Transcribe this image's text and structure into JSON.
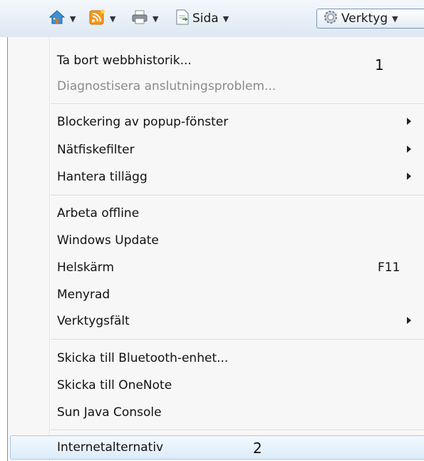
{
  "toolbar": {
    "sida_label": "Sida",
    "verktyg_label": "Verktyg"
  },
  "menu": {
    "items": [
      {
        "label": "Ta bort webbhistorik...",
        "enabled": true
      },
      {
        "label": "Diagnostisera anslutningsproblem...",
        "enabled": false
      },
      {
        "label": "Blockering av popup-fönster",
        "submenu": true
      },
      {
        "label": "Nätfiskefilter",
        "submenu": true
      },
      {
        "label": "Hantera tillägg",
        "submenu": true
      },
      {
        "label": "Arbeta offline"
      },
      {
        "label": "Windows Update"
      },
      {
        "label": "Helskärm",
        "shortcut": "F11"
      },
      {
        "label": "Menyrad"
      },
      {
        "label": "Verktygsfält",
        "submenu": true
      },
      {
        "label": "Skicka till Bluetooth-enhet..."
      },
      {
        "label": "Skicka till OneNote"
      },
      {
        "label": "Sun Java Console"
      },
      {
        "label": "Internetalternativ",
        "highlighted": true
      }
    ]
  },
  "annotations": {
    "one": "1",
    "two": "2"
  },
  "colors": {
    "highlight_border": "#a6c8e6",
    "menu_background": "#f7f7f7"
  }
}
